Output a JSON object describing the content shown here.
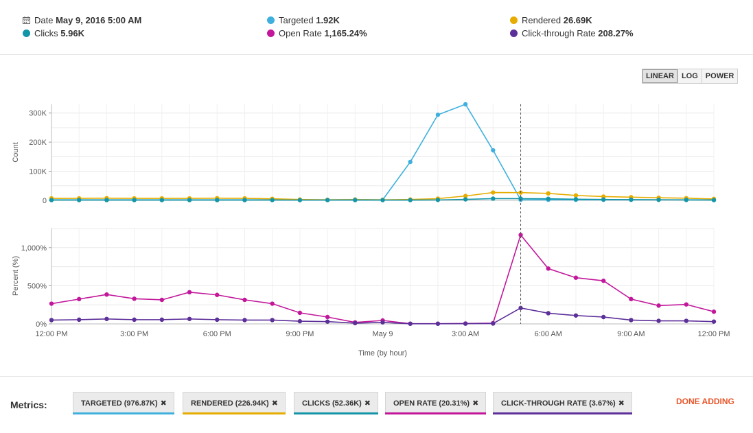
{
  "header": {
    "date": {
      "label": "Date",
      "value": "May 9, 2016 5:00 AM",
      "icon": "calendar-icon"
    },
    "clicks": {
      "label": "Clicks",
      "value": "5.96K",
      "color": "#1495a8"
    },
    "targeted": {
      "label": "Targeted",
      "value": "1.92K",
      "color": "#3fb0de"
    },
    "open_rate": {
      "label": "Open Rate",
      "value": "1,165.24%",
      "color": "#c2179b"
    },
    "rendered": {
      "label": "Rendered",
      "value": "26.69K",
      "color": "#e6ad00"
    },
    "ctr": {
      "label": "Click-through Rate",
      "value": "208.27%",
      "color": "#5c2f99"
    }
  },
  "scale_buttons": {
    "linear": "LINEAR",
    "log": "LOG",
    "power": "POWER",
    "active": "LINEAR"
  },
  "chart_data": [
    {
      "type": "line",
      "ylabel": "Count",
      "ylim": [
        0,
        330000
      ],
      "yticks": [
        0,
        100000,
        200000,
        300000
      ],
      "ytick_labels": [
        "0",
        "100K",
        "200K",
        "300K"
      ],
      "grid": true,
      "x": [
        "12:00 PM",
        "1:00 PM",
        "2:00 PM",
        "3:00 PM",
        "4:00 PM",
        "5:00 PM",
        "6:00 PM",
        "7:00 PM",
        "8:00 PM",
        "9:00 PM",
        "10:00 PM",
        "11:00 PM",
        "May 9",
        "1:00 AM",
        "2:00 AM",
        "3:00 AM",
        "4:00 AM",
        "5:00 AM",
        "6:00 AM",
        "7:00 AM",
        "8:00 AM",
        "9:00 AM",
        "10:00 AM",
        "11:00 AM",
        "12:00 PM"
      ],
      "series": [
        {
          "name": "Targeted",
          "color": "#3fb0de",
          "values": [
            2000,
            2000,
            2000,
            2000,
            2000,
            2000,
            2000,
            2000,
            2000,
            2000,
            2000,
            3000,
            2000,
            132000,
            294000,
            330000,
            172000,
            1920,
            2000,
            2000,
            2000,
            2000,
            2000,
            2000,
            2000
          ]
        },
        {
          "name": "Rendered",
          "color": "#e6ad00",
          "values": [
            7000,
            7000,
            7500,
            7000,
            7000,
            7000,
            7500,
            7000,
            5500,
            3000,
            2000,
            2500,
            2000,
            3000,
            6000,
            15000,
            27000,
            26690,
            24000,
            17000,
            13000,
            11000,
            9000,
            7500,
            5000
          ]
        },
        {
          "name": "Clicks",
          "color": "#1495a8",
          "values": [
            1000,
            1000,
            1000,
            1000,
            1000,
            1000,
            1000,
            1000,
            1000,
            1000,
            1000,
            1000,
            1000,
            1000,
            1500,
            3500,
            6000,
            5960,
            5500,
            4000,
            3000,
            2500,
            2000,
            1500,
            1000
          ]
        }
      ]
    },
    {
      "type": "line",
      "ylabel": "Percent (%)",
      "ylim": [
        0,
        1250
      ],
      "yticks": [
        0,
        500,
        1000
      ],
      "ytick_labels": [
        "0%",
        "500%",
        "1,000%"
      ],
      "grid": true,
      "x": [
        "12:00 PM",
        "1:00 PM",
        "2:00 PM",
        "3:00 PM",
        "4:00 PM",
        "5:00 PM",
        "6:00 PM",
        "7:00 PM",
        "8:00 PM",
        "9:00 PM",
        "10:00 PM",
        "11:00 PM",
        "May 9",
        "1:00 AM",
        "2:00 AM",
        "3:00 AM",
        "4:00 AM",
        "5:00 AM",
        "6:00 AM",
        "7:00 AM",
        "8:00 AM",
        "9:00 AM",
        "10:00 AM",
        "11:00 AM",
        "12:00 PM"
      ],
      "series": [
        {
          "name": "Open Rate",
          "color": "#c2179b",
          "values": [
            265,
            325,
            385,
            330,
            315,
            415,
            380,
            315,
            265,
            145,
            90,
            20,
            45,
            3,
            3,
            5,
            10,
            1165.24,
            725,
            605,
            565,
            325,
            240,
            255,
            160
          ]
        },
        {
          "name": "Click-through Rate",
          "color": "#5c2f99",
          "values": [
            50,
            55,
            65,
            55,
            55,
            65,
            55,
            50,
            50,
            35,
            30,
            10,
            20,
            2,
            2,
            3,
            5,
            208.27,
            140,
            110,
            90,
            50,
            40,
            40,
            30
          ]
        }
      ],
      "xlabel": "Time (by hour)",
      "xtick_labels": [
        "12:00 PM",
        "3:00 PM",
        "6:00 PM",
        "9:00 PM",
        "May 9",
        "3:00 AM",
        "6:00 AM",
        "9:00 AM",
        "12:00 PM"
      ],
      "xtick_indices": [
        0,
        3,
        6,
        9,
        12,
        15,
        18,
        21,
        24
      ],
      "marker_index": 17
    }
  ],
  "footer": {
    "metrics_label": "Metrics:",
    "pills": [
      {
        "label": "TARGETED (976.87K)",
        "color": "#3fb0de"
      },
      {
        "label": "RENDERED (226.94K)",
        "color": "#e6ad00"
      },
      {
        "label": "CLICKS (52.36K)",
        "color": "#1495a8"
      },
      {
        "label": "OPEN RATE (20.31%)",
        "color": "#c2179b"
      },
      {
        "label": "CLICK-THROUGH RATE (3.67%)",
        "color": "#5c2f99"
      }
    ],
    "remove_glyph": "✖",
    "done_label": "DONE ADDING"
  }
}
